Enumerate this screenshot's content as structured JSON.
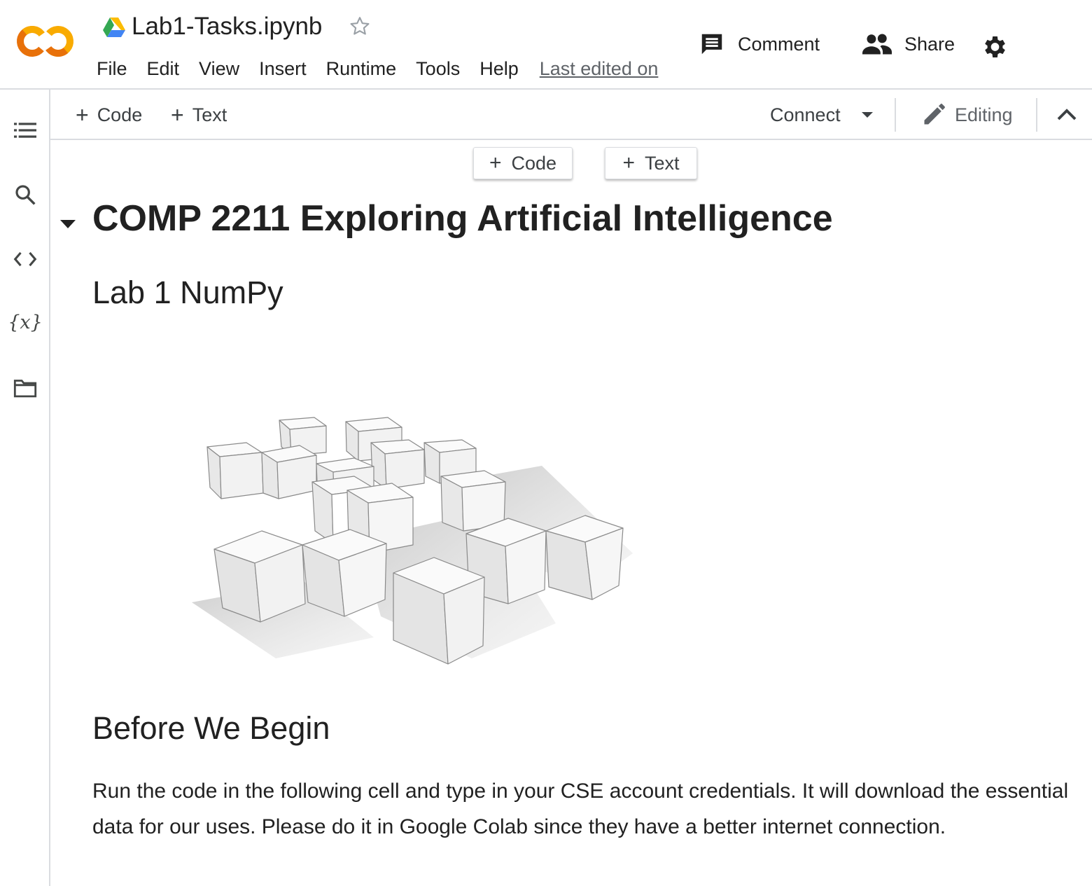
{
  "header": {
    "file_name": "Lab1-Tasks.ipynb",
    "menu": [
      "File",
      "Edit",
      "View",
      "Insert",
      "Runtime",
      "Tools",
      "Help"
    ],
    "last_edited": "Last edited on",
    "comment_label": "Comment",
    "share_label": "Share"
  },
  "left_rail": {
    "icons": [
      "table-of-contents-icon",
      "search-icon",
      "code-snippets-icon",
      "variables-icon",
      "files-icon"
    ],
    "variables_glyph": "{x}"
  },
  "toolbar": {
    "add_code_label": "Code",
    "add_text_label": "Text",
    "connect_label": "Connect",
    "editing_label": "Editing"
  },
  "cell_toolbar": {
    "add_code_label": "Code",
    "add_text_label": "Text"
  },
  "notebook": {
    "title": "COMP 2211 Exploring Artificial Intelligence",
    "subtitle": "Lab 1 NumPy",
    "section_heading": "Before We Begin",
    "paragraph": "Run the code in the following cell and type in your CSE account credentials. It will download the essential data for our uses. Please do it in Google Colab since they have a better internet connection."
  },
  "colors": {
    "colab_orange": "#F9AB00",
    "colab_dark_orange": "#E8710A",
    "divider": "#dadce0"
  }
}
